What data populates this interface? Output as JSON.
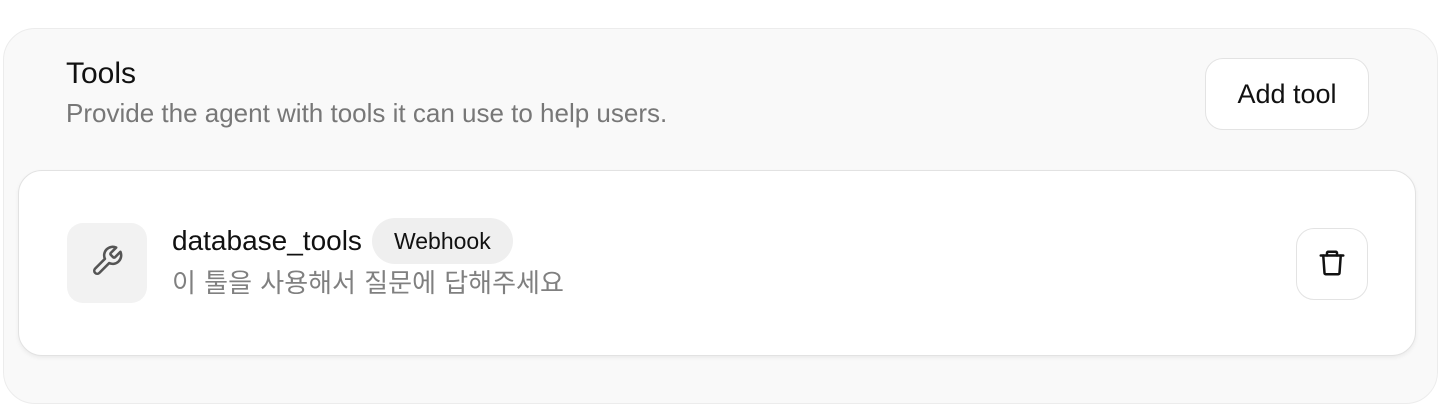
{
  "section": {
    "title": "Tools",
    "description": "Provide the agent with tools it can use to help users.",
    "add_button_label": "Add tool"
  },
  "tools": [
    {
      "name": "database_tools",
      "type_badge": "Webhook",
      "description": "이 툴을 사용해서 질문에 답해주세요",
      "icon": "wrench-icon"
    }
  ],
  "icons": {
    "tool": "wrench-icon",
    "delete": "trash-icon"
  },
  "colors": {
    "panel_background": "#f9f9f9",
    "card_background": "#ffffff",
    "muted_text": "#777777"
  }
}
